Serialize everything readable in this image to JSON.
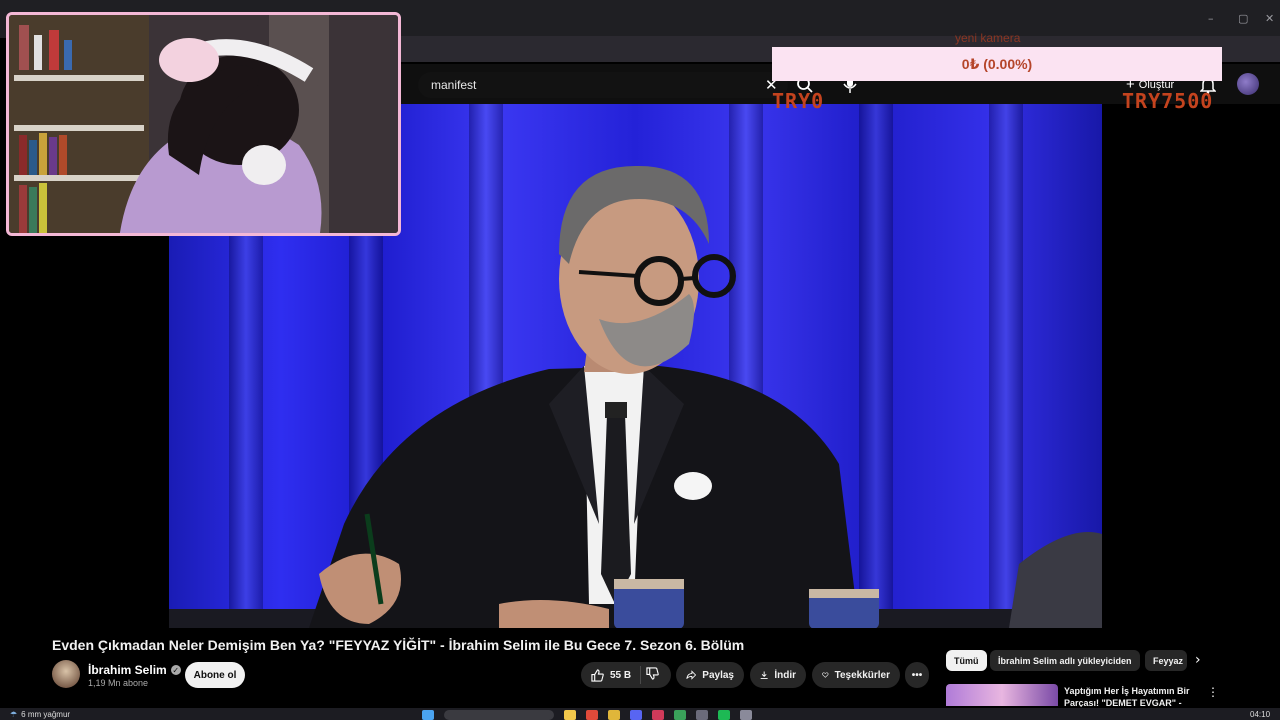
{
  "browser": {
    "window_controls": {
      "minimize": "–",
      "maximize": "▢",
      "close": "✕"
    }
  },
  "youtube": {
    "search": {
      "query": "manifest",
      "clear": "✕"
    },
    "create_label": "Oluştur",
    "create_plus": "+"
  },
  "overlays": {
    "donation": "0₺ (0.00%)",
    "camera_label": "yeni kamera",
    "goal_left": "TRY0",
    "goal_right": "TRY7500"
  },
  "video": {
    "title": "Evden Çıkmadan Neler Demişim Ben Ya? \"FEYYAZ YİĞİT\" - İbrahim Selim ile Bu Gece 7. Sezon 6. Bölüm",
    "channel": {
      "name": "İbrahim Selim",
      "verified": "✓",
      "subscribers": "1,19 Mn abone"
    },
    "subscribe_label": "Abone ol",
    "actions": {
      "likes": "55 B",
      "share": "Paylaş",
      "download": "İndir",
      "thanks": "Teşekkürler",
      "more": "•••"
    }
  },
  "recommendations": {
    "chips": [
      "Tümü",
      "İbrahim Selim adlı yükleyiciden",
      "Feyyaz"
    ],
    "next": "›",
    "first_title": "Yaptığım Her İş Hayatımın Bir Parçası! \"DEMET EVGAR\" -",
    "menu": "⋮"
  },
  "taskbar": {
    "weather": "6 mm yağmur",
    "time": "04:10"
  },
  "colors": {
    "donation_bg": "#fbe3f2",
    "goal_text": "#c4431e",
    "webcam_border": "#f4b8d6",
    "stage_blue": "#2f2ef0"
  }
}
